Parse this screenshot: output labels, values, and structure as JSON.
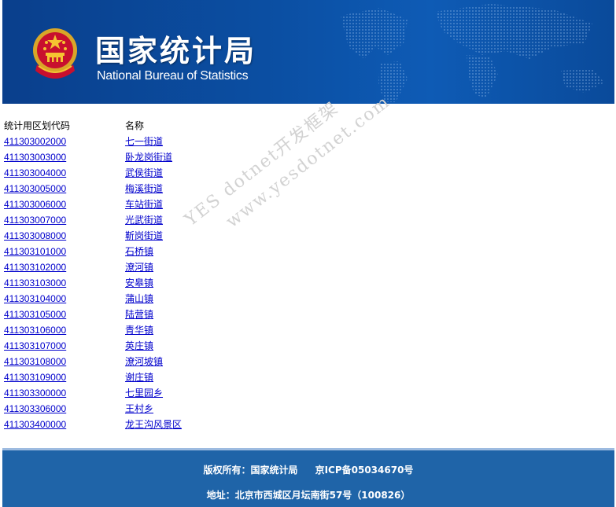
{
  "header": {
    "title_cn": "国家统计局",
    "title_en": "National Bureau of Statistics",
    "emblem_icon": "national-emblem-icon",
    "background_icon": "world-map-icon",
    "colors": {
      "banner": "#0b4fa3",
      "text": "#ffffff"
    }
  },
  "table": {
    "headers": {
      "code": "统计用区划代码",
      "name": "名称"
    },
    "rows": [
      {
        "code": "411303002000",
        "name": "七一街道"
      },
      {
        "code": "411303003000",
        "name": "卧龙岗街道"
      },
      {
        "code": "411303004000",
        "name": "武侯街道"
      },
      {
        "code": "411303005000",
        "name": "梅溪街道"
      },
      {
        "code": "411303006000",
        "name": "车站街道"
      },
      {
        "code": "411303007000",
        "name": "光武街道"
      },
      {
        "code": "411303008000",
        "name": "靳岗街道"
      },
      {
        "code": "411303101000",
        "name": "石桥镇"
      },
      {
        "code": "411303102000",
        "name": "潦河镇"
      },
      {
        "code": "411303103000",
        "name": "安皋镇"
      },
      {
        "code": "411303104000",
        "name": "蒲山镇"
      },
      {
        "code": "411303105000",
        "name": "陆营镇"
      },
      {
        "code": "411303106000",
        "name": "青华镇"
      },
      {
        "code": "411303107000",
        "name": "英庄镇"
      },
      {
        "code": "411303108000",
        "name": "潦河坡镇"
      },
      {
        "code": "411303109000",
        "name": "谢庄镇"
      },
      {
        "code": "411303300000",
        "name": "七里园乡"
      },
      {
        "code": "411303306000",
        "name": "王村乡"
      },
      {
        "code": "411303400000",
        "name": "龙王沟风景区"
      }
    ],
    "colors": {
      "link": "#0000cc"
    }
  },
  "watermark": {
    "line1": "YES dotnet开发框架",
    "line2": "www.yesdotnet.com"
  },
  "footer": {
    "copyright": "版权所有：国家统计局",
    "icp": "京ICP备05034670号",
    "address": "地址：北京市西城区月坛南街57号（100826）",
    "colors": {
      "background": "#1f64a8"
    }
  }
}
